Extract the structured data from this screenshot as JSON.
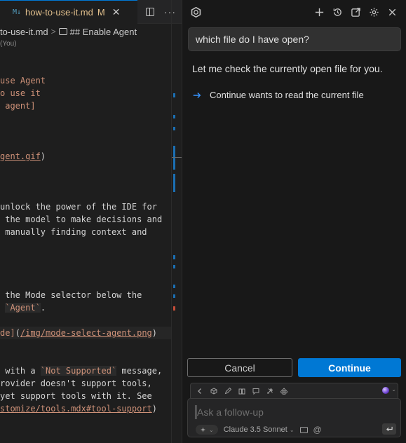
{
  "editor": {
    "tab": {
      "file_icon": "M↓",
      "title": "how-to-use-it.md",
      "modified_badge": "M",
      "close_glyph": "✕"
    },
    "more_glyph": "···",
    "breadcrumb": {
      "file": "to-use-it.md",
      "separator": ">",
      "section": "## Enable Agent"
    },
    "blame": "(You)",
    "code_lines": [
      {
        "parts": [
          {
            "t": "use Agent",
            "c": "c-orange"
          }
        ]
      },
      {
        "parts": [
          {
            "t": "o use it",
            "c": "c-orange"
          }
        ]
      },
      {
        "parts": [
          {
            "t": " agent]",
            "c": "c-orange"
          }
        ]
      },
      {
        "parts": []
      },
      {
        "parts": []
      },
      {
        "parts": []
      },
      {
        "parts": [
          {
            "t": "gent.gif",
            "c": "c-link"
          },
          {
            "t": ")",
            "c": "c-text"
          }
        ]
      },
      {
        "parts": []
      },
      {
        "parts": []
      },
      {
        "parts": []
      },
      {
        "parts": [
          {
            "t": "unlock the power of the IDE for",
            "c": "c-text"
          }
        ]
      },
      {
        "parts": [
          {
            "t": " the model to make decisions and",
            "c": "c-text"
          }
        ]
      },
      {
        "parts": [
          {
            "t": " manually finding context and",
            "c": "c-text"
          }
        ]
      },
      {
        "parts": []
      },
      {
        "parts": []
      },
      {
        "parts": []
      },
      {
        "parts": []
      },
      {
        "parts": [
          {
            "t": " the Mode selector below the",
            "c": "c-text"
          }
        ]
      },
      {
        "parts": [
          {
            "t": " ",
            "c": "c-text"
          },
          {
            "t": "`Agent`",
            "c": "c-code"
          },
          {
            "t": ".",
            "c": "c-text"
          }
        ]
      },
      {
        "parts": []
      },
      {
        "parts": [
          {
            "t": "de]",
            "c": "c-orange"
          },
          {
            "t": "(",
            "c": "c-text"
          },
          {
            "t": "/img/mode-select-agent.png",
            "c": "c-link"
          },
          {
            "t": ")",
            "c": "c-text"
          }
        ],
        "hl": true
      },
      {
        "parts": []
      },
      {
        "parts": []
      },
      {
        "parts": [
          {
            "t": " with a ",
            "c": "c-text"
          },
          {
            "t": "`Not Supported`",
            "c": "c-code"
          },
          {
            "t": " message,",
            "c": "c-text"
          }
        ]
      },
      {
        "parts": [
          {
            "t": "rovider doesn't support tools,",
            "c": "c-text"
          }
        ]
      },
      {
        "parts": [
          {
            "t": "yet support tools with it. See",
            "c": "c-text"
          }
        ]
      },
      {
        "parts": [
          {
            "t": "stomize/tools.mdx#tool-support",
            "c": "c-link"
          },
          {
            "t": ")",
            "c": "c-text"
          }
        ]
      }
    ]
  },
  "chat": {
    "icons": [
      "continue-logo-icon",
      "plus-icon",
      "history-icon",
      "open-external-icon",
      "gear-icon",
      "close-icon"
    ],
    "user_message": "which file do I have open?",
    "assistant_message": "Let me check the currently open file for you.",
    "tool_call": "Continue wants to read the current file",
    "cancel_label": "Cancel",
    "continue_label": "Continue",
    "input_placeholder": "Ask a follow-up",
    "model_name": "Claude 3.5 Sonnet",
    "at_symbol": "@",
    "accent_color": "#0078d4"
  }
}
